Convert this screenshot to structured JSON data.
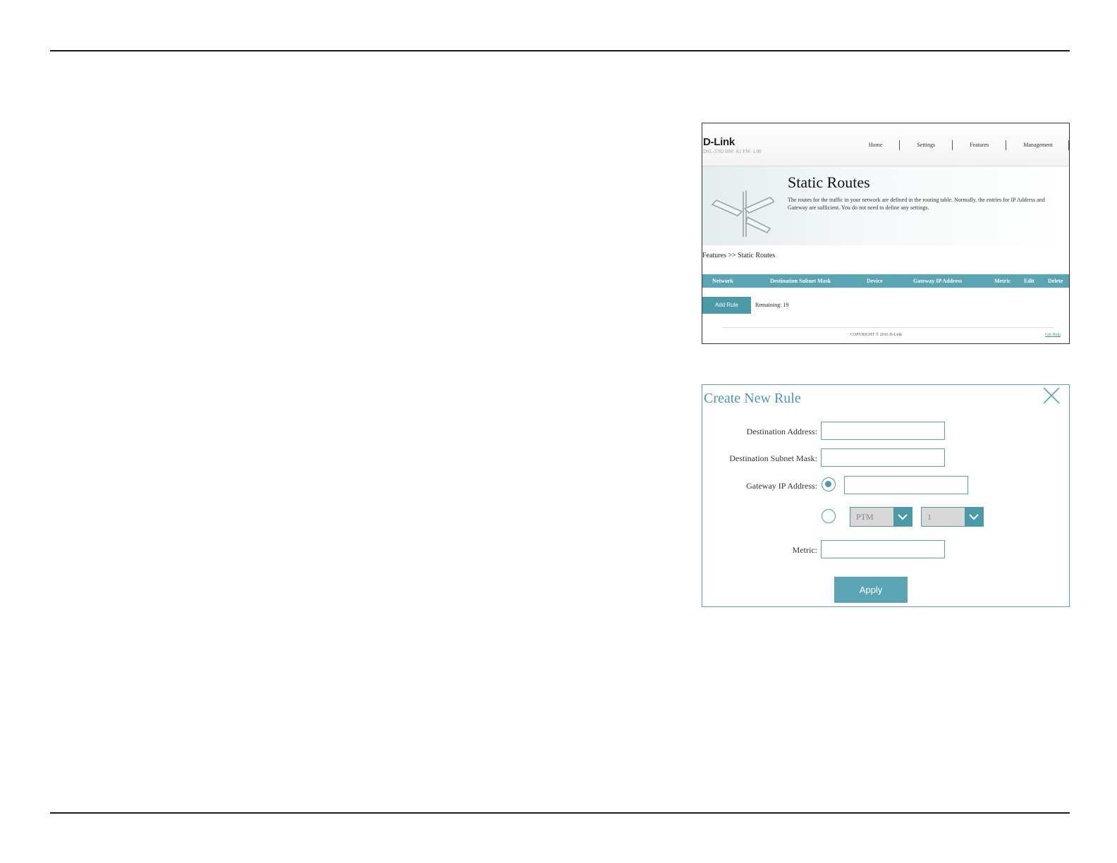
{
  "header": {
    "logo": "D-Link",
    "model": "DSL-3782  HW: A1  FW: 1.00",
    "nav": [
      "Home",
      "Settings",
      "Features",
      "Management"
    ]
  },
  "banner": {
    "title": "Static Routes",
    "description": "The routes for the traffic in your network are defined in the routing table. Normally, the entries for IP Address and Gateway are sufficient. You do not need to define any settings."
  },
  "breadcrumb": "Features >> Static Routes",
  "table": {
    "columns": [
      "Network",
      "Destination Subnet Mask",
      "Device",
      "Gateway IP Address",
      "Metric",
      "Edit",
      "Delete"
    ]
  },
  "actions": {
    "add_rule": "Add Rule",
    "remaining": "Remaining: 19"
  },
  "footer": {
    "copyright": "COPYRIGHT © 2016 D-Link",
    "help": "Get Help"
  },
  "dialog": {
    "title": "Create New Rule",
    "labels": {
      "destination_address": "Destination Address:",
      "destination_subnet_mask": "Destination Subnet Mask:",
      "gateway_ip_address": "Gateway IP Address:",
      "metric": "Metric:"
    },
    "values": {
      "destination_address": "",
      "destination_subnet_mask": "",
      "gateway_ip_address": "",
      "metric": ""
    },
    "interface_select": "PTM",
    "index_select": "1",
    "apply": "Apply"
  },
  "colors": {
    "accent": "#5aa5b3",
    "accent_dark": "#4a9aa8"
  }
}
